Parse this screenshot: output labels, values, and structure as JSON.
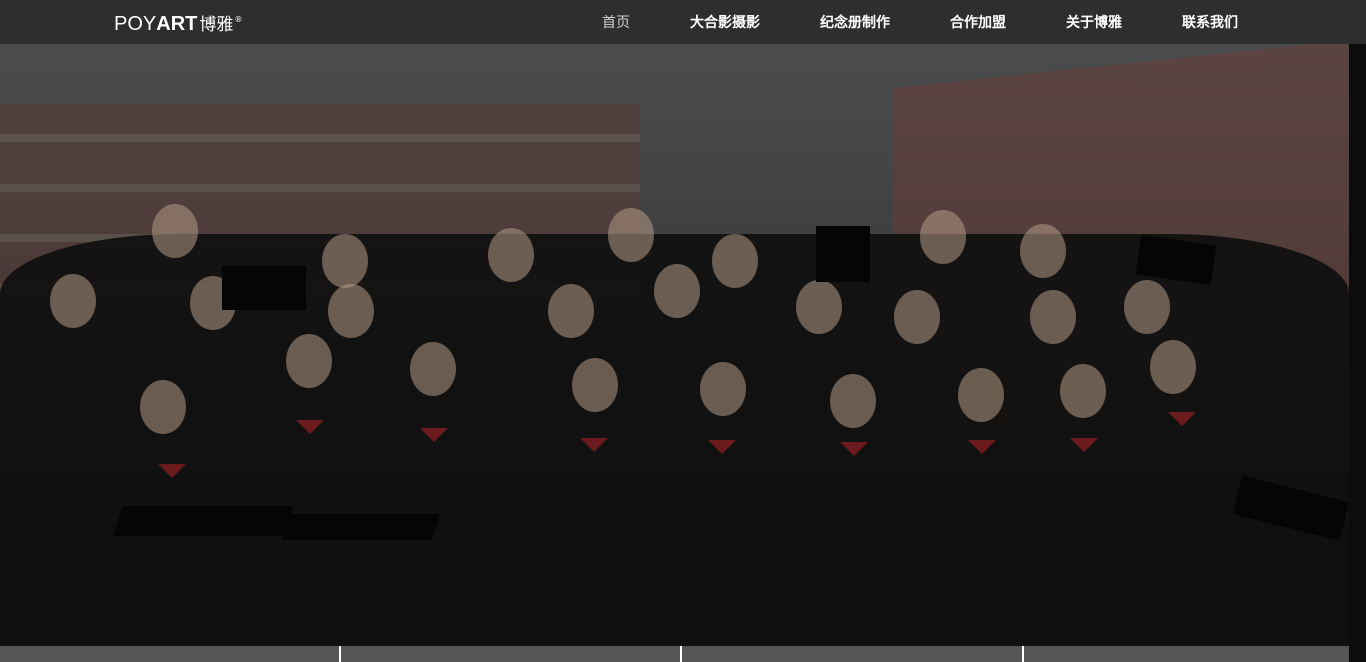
{
  "logo": {
    "latin_light": "POY",
    "latin_bold": "ART",
    "chinese": "博雅",
    "tm": "®"
  },
  "nav": {
    "items": [
      {
        "label": "首页",
        "active": true
      },
      {
        "label": "大合影摄影",
        "active": false
      },
      {
        "label": "纪念册制作",
        "active": false
      },
      {
        "label": "合作加盟",
        "active": false
      },
      {
        "label": "关于博雅",
        "active": false
      },
      {
        "label": "联系我们",
        "active": false
      }
    ]
  },
  "hero": {
    "image": "graduation-group-photo"
  },
  "thumbnails": {
    "count": 4
  },
  "colors": {
    "topbar": "#2d2f2e",
    "nav_text": "#ffffff",
    "nav_active": "#cfcfcf"
  }
}
